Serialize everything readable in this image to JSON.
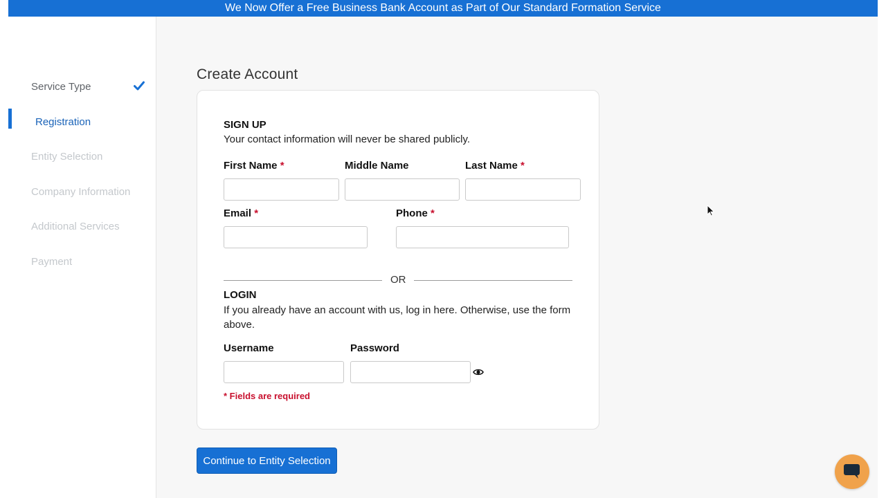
{
  "banner": {
    "text": "We Now Offer a Free Business Bank Account as Part of Our Standard Formation Service"
  },
  "sidebar": {
    "steps": [
      {
        "label": "Service Type",
        "status": "done"
      },
      {
        "label": "Registration",
        "status": "active"
      },
      {
        "label": "Entity Selection",
        "status": "upcoming"
      },
      {
        "label": "Company Information",
        "status": "upcoming"
      },
      {
        "label": "Additional Services",
        "status": "upcoming"
      },
      {
        "label": "Payment",
        "status": "upcoming"
      }
    ],
    "check_icon": "checkmark-icon"
  },
  "main": {
    "title": "Create Account",
    "signup": {
      "title": "SIGN UP",
      "subtitle": "Your contact information will never be shared publicly.",
      "fields": {
        "first_name": {
          "label": "First Name",
          "required": "*",
          "value": ""
        },
        "middle_name": {
          "label": "Middle Name",
          "value": ""
        },
        "last_name": {
          "label": "Last Name",
          "required": "*",
          "value": ""
        },
        "email": {
          "label": "Email",
          "required": "*",
          "value": ""
        },
        "phone": {
          "label": "Phone",
          "required": "*",
          "value": ""
        }
      }
    },
    "divider_text": "OR",
    "login": {
      "title": "LOGIN",
      "subtitle_line1": "If you already have an account with us, log in here. Otherwise, use the form",
      "subtitle_line2": "above.",
      "fields": {
        "username": {
          "label": "Username",
          "value": ""
        },
        "password": {
          "label": "Password",
          "value": ""
        }
      },
      "reveal_icon": "eye-icon"
    },
    "required_note": "* Fields are required",
    "continue_button": "Continue to Entity Selection"
  },
  "colors": {
    "accent": "#1770d4",
    "required": "#c8102e",
    "chat": "#f0a24b"
  },
  "chat": {
    "icon": "chat-bubble-icon"
  }
}
